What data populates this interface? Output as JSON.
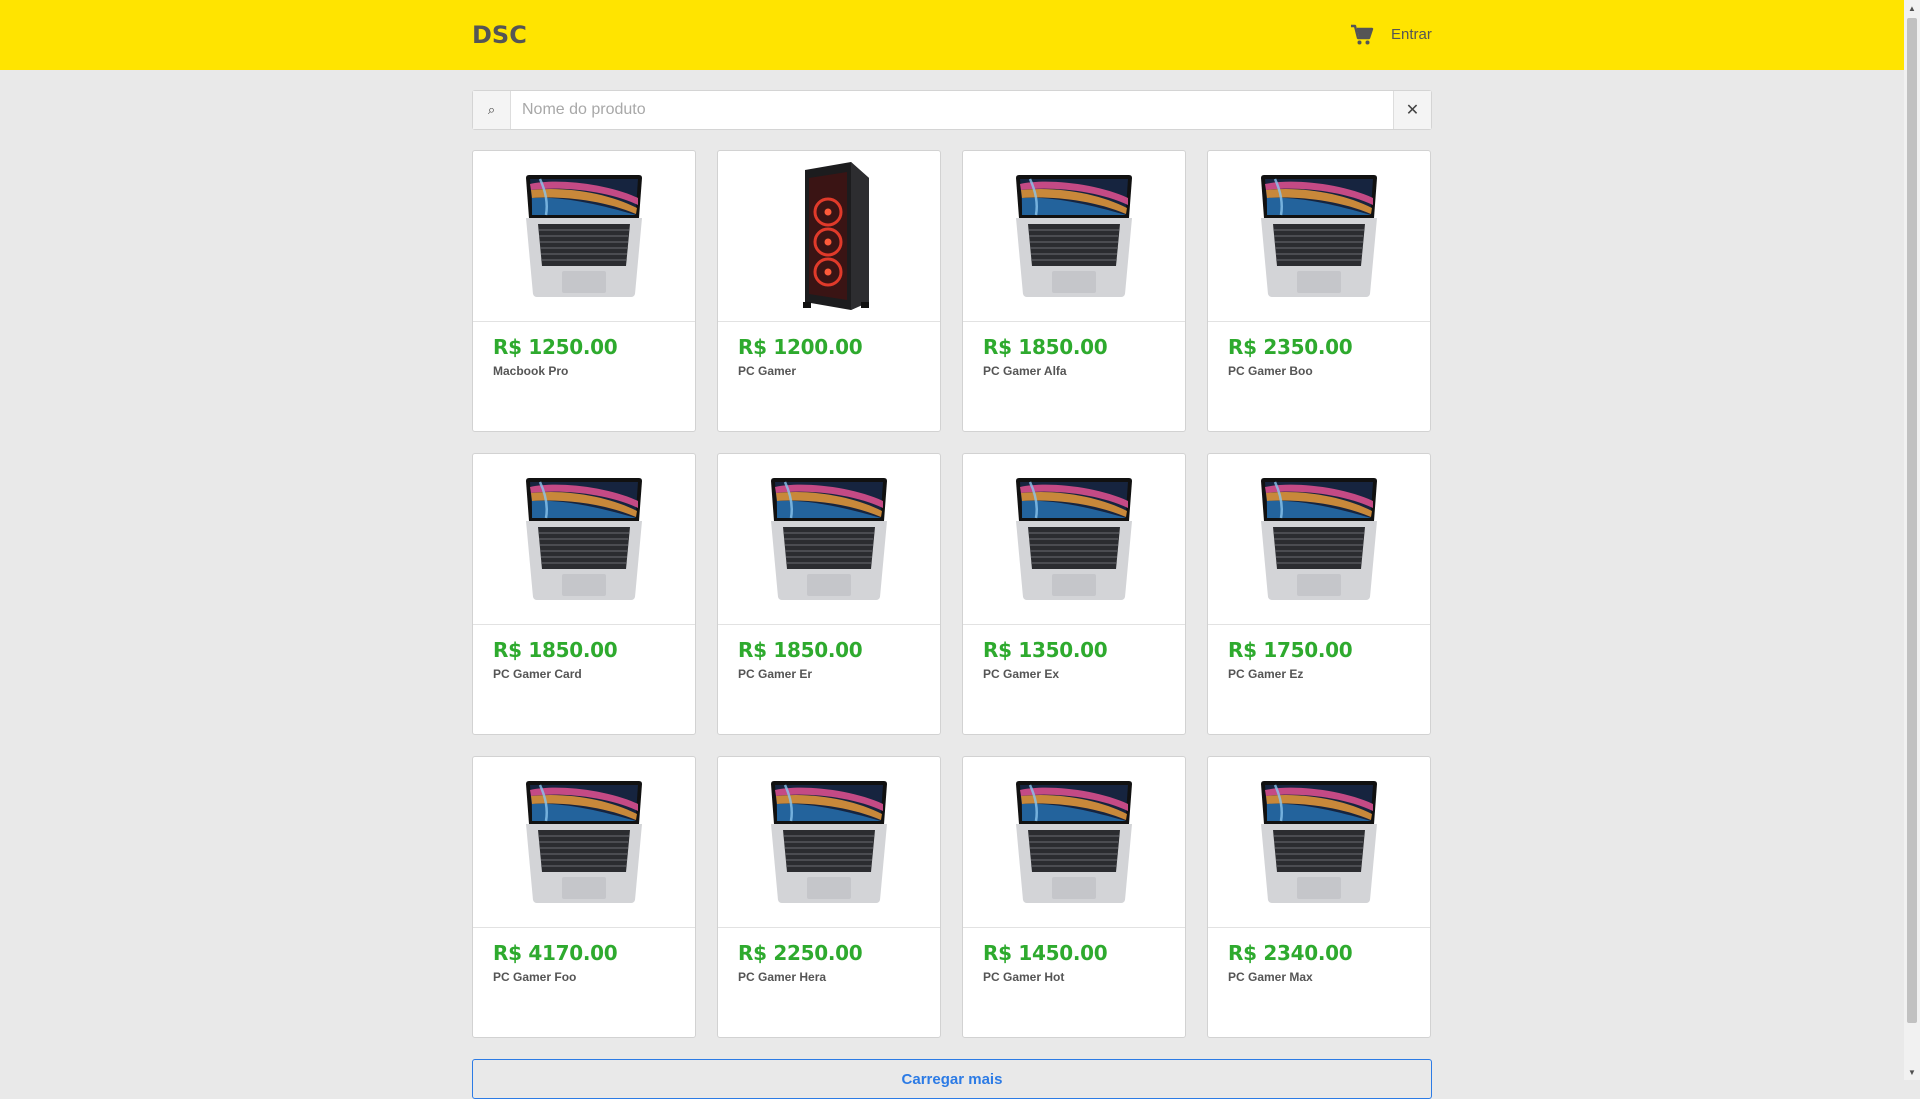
{
  "navbar": {
    "brand": "DSC",
    "cart_icon": "shopping-cart-icon",
    "login_label": "Entrar",
    "bg_color": "#ffe400"
  },
  "search": {
    "placeholder": "Nome do produto",
    "value": "",
    "search_icon": "search-icon",
    "clear_icon": "close-icon",
    "clear_glyph": "✕",
    "search_glyph": "⌕"
  },
  "products": [
    {
      "price": "R$ 1250.00",
      "name": "Macbook Pro",
      "image": "laptop"
    },
    {
      "price": "R$ 1200.00",
      "name": "PC Gamer",
      "image": "tower"
    },
    {
      "price": "R$ 1850.00",
      "name": "PC Gamer Alfa",
      "image": "laptop"
    },
    {
      "price": "R$ 2350.00",
      "name": "PC Gamer Boo",
      "image": "laptop"
    },
    {
      "price": "R$ 1850.00",
      "name": "PC Gamer Card",
      "image": "laptop"
    },
    {
      "price": "R$ 1850.00",
      "name": "PC Gamer Er",
      "image": "laptop"
    },
    {
      "price": "R$ 1350.00",
      "name": "PC Gamer Ex",
      "image": "laptop"
    },
    {
      "price": "R$ 1750.00",
      "name": "PC Gamer Ez",
      "image": "laptop"
    },
    {
      "price": "R$ 4170.00",
      "name": "PC Gamer Foo",
      "image": "laptop"
    },
    {
      "price": "R$ 2250.00",
      "name": "PC Gamer Hera",
      "image": "laptop"
    },
    {
      "price": "R$ 1450.00",
      "name": "PC Gamer Hot",
      "image": "laptop"
    },
    {
      "price": "R$ 2340.00",
      "name": "PC Gamer Max",
      "image": "laptop"
    }
  ],
  "load_more": {
    "label": "Carregar mais"
  },
  "colors": {
    "price": "#2eaa2e",
    "accent": "#2c7be5",
    "page_bg": "#e9e9e9"
  }
}
